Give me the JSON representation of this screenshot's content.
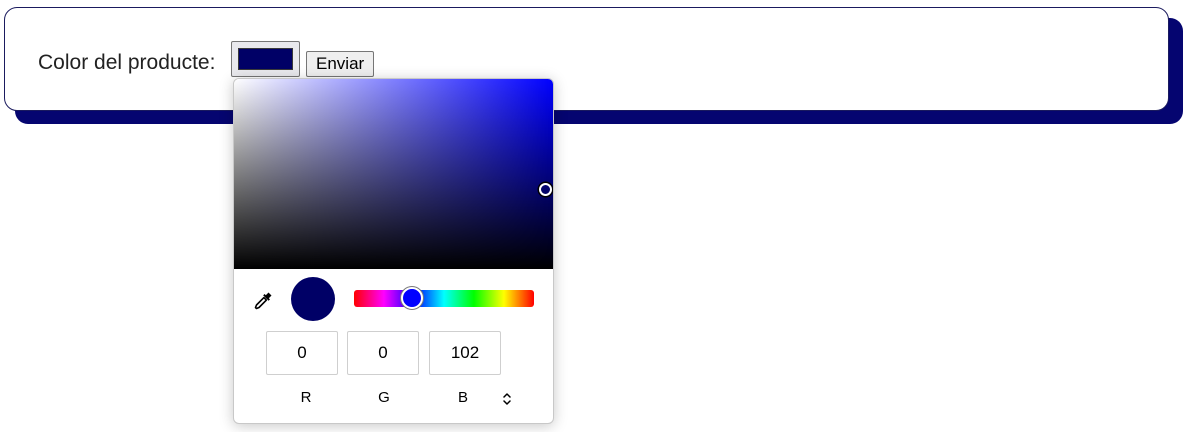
{
  "form": {
    "label": "Color del producte:",
    "submit_label": "Enviar",
    "color_value": "#000066"
  },
  "picker": {
    "channels": [
      {
        "label": "R",
        "value": "0"
      },
      {
        "label": "G",
        "value": "0"
      },
      {
        "label": "B",
        "value": "102"
      }
    ],
    "hue_color": "#0000ff",
    "icons": [
      "eyedropper-icon",
      "format-toggle-icon"
    ]
  },
  "colors": {
    "accent_navy": "#000066",
    "card_shadow": "#050570"
  }
}
